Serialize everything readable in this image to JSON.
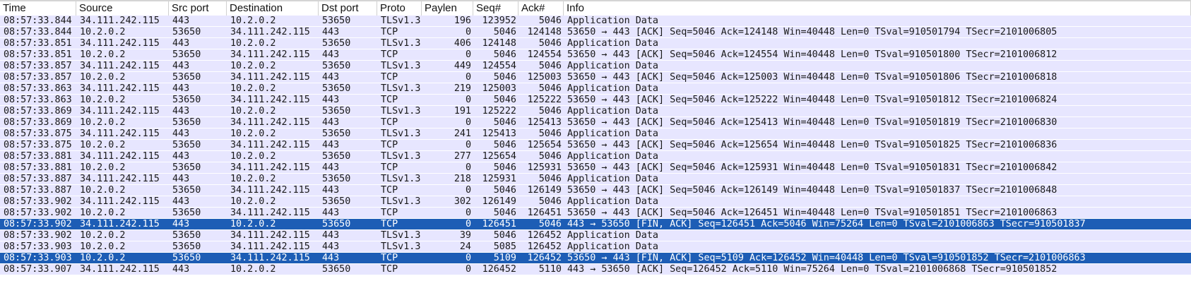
{
  "columns": [
    "Time",
    "Source",
    "Src port",
    "Destination",
    "Dst port",
    "Proto",
    "Paylen",
    "Seq#",
    "Ack#",
    "Info"
  ],
  "selected_color": "#1d5db5",
  "row_color": "#e7e6ff",
  "rows": [
    [
      "08:57:33.844",
      "34.111.242.115",
      "443",
      "10.2.0.2",
      "53650",
      "TLSv1.3",
      "196",
      "123952",
      "5046",
      "Application Data",
      false
    ],
    [
      "08:57:33.844",
      "10.2.0.2",
      "53650",
      "34.111.242.115",
      "443",
      "TCP",
      "0",
      "5046",
      "124148",
      "53650 → 443 [ACK] Seq=5046 Ack=124148 Win=40448 Len=0 TSval=910501794 TSecr=2101006805",
      false
    ],
    [
      "08:57:33.851",
      "34.111.242.115",
      "443",
      "10.2.0.2",
      "53650",
      "TLSv1.3",
      "406",
      "124148",
      "5046",
      "Application Data",
      false
    ],
    [
      "08:57:33.851",
      "10.2.0.2",
      "53650",
      "34.111.242.115",
      "443",
      "TCP",
      "0",
      "5046",
      "124554",
      "53650 → 443 [ACK] Seq=5046 Ack=124554 Win=40448 Len=0 TSval=910501800 TSecr=2101006812",
      false
    ],
    [
      "08:57:33.857",
      "34.111.242.115",
      "443",
      "10.2.0.2",
      "53650",
      "TLSv1.3",
      "449",
      "124554",
      "5046",
      "Application Data",
      false
    ],
    [
      "08:57:33.857",
      "10.2.0.2",
      "53650",
      "34.111.242.115",
      "443",
      "TCP",
      "0",
      "5046",
      "125003",
      "53650 → 443 [ACK] Seq=5046 Ack=125003 Win=40448 Len=0 TSval=910501806 TSecr=2101006818",
      false
    ],
    [
      "08:57:33.863",
      "34.111.242.115",
      "443",
      "10.2.0.2",
      "53650",
      "TLSv1.3",
      "219",
      "125003",
      "5046",
      "Application Data",
      false
    ],
    [
      "08:57:33.863",
      "10.2.0.2",
      "53650",
      "34.111.242.115",
      "443",
      "TCP",
      "0",
      "5046",
      "125222",
      "53650 → 443 [ACK] Seq=5046 Ack=125222 Win=40448 Len=0 TSval=910501812 TSecr=2101006824",
      false
    ],
    [
      "08:57:33.869",
      "34.111.242.115",
      "443",
      "10.2.0.2",
      "53650",
      "TLSv1.3",
      "191",
      "125222",
      "5046",
      "Application Data",
      false
    ],
    [
      "08:57:33.869",
      "10.2.0.2",
      "53650",
      "34.111.242.115",
      "443",
      "TCP",
      "0",
      "5046",
      "125413",
      "53650 → 443 [ACK] Seq=5046 Ack=125413 Win=40448 Len=0 TSval=910501819 TSecr=2101006830",
      false
    ],
    [
      "08:57:33.875",
      "34.111.242.115",
      "443",
      "10.2.0.2",
      "53650",
      "TLSv1.3",
      "241",
      "125413",
      "5046",
      "Application Data",
      false
    ],
    [
      "08:57:33.875",
      "10.2.0.2",
      "53650",
      "34.111.242.115",
      "443",
      "TCP",
      "0",
      "5046",
      "125654",
      "53650 → 443 [ACK] Seq=5046 Ack=125654 Win=40448 Len=0 TSval=910501825 TSecr=2101006836",
      false
    ],
    [
      "08:57:33.881",
      "34.111.242.115",
      "443",
      "10.2.0.2",
      "53650",
      "TLSv1.3",
      "277",
      "125654",
      "5046",
      "Application Data",
      false
    ],
    [
      "08:57:33.881",
      "10.2.0.2",
      "53650",
      "34.111.242.115",
      "443",
      "TCP",
      "0",
      "5046",
      "125931",
      "53650 → 443 [ACK] Seq=5046 Ack=125931 Win=40448 Len=0 TSval=910501831 TSecr=2101006842",
      false
    ],
    [
      "08:57:33.887",
      "34.111.242.115",
      "443",
      "10.2.0.2",
      "53650",
      "TLSv1.3",
      "218",
      "125931",
      "5046",
      "Application Data",
      false
    ],
    [
      "08:57:33.887",
      "10.2.0.2",
      "53650",
      "34.111.242.115",
      "443",
      "TCP",
      "0",
      "5046",
      "126149",
      "53650 → 443 [ACK] Seq=5046 Ack=126149 Win=40448 Len=0 TSval=910501837 TSecr=2101006848",
      false
    ],
    [
      "08:57:33.902",
      "34.111.242.115",
      "443",
      "10.2.0.2",
      "53650",
      "TLSv1.3",
      "302",
      "126149",
      "5046",
      "Application Data",
      false
    ],
    [
      "08:57:33.902",
      "10.2.0.2",
      "53650",
      "34.111.242.115",
      "443",
      "TCP",
      "0",
      "5046",
      "126451",
      "53650 → 443 [ACK] Seq=5046 Ack=126451 Win=40448 Len=0 TSval=910501851 TSecr=2101006863",
      false
    ],
    [
      "08:57:33.902",
      "34.111.242.115",
      "443",
      "10.2.0.2",
      "53650",
      "TCP",
      "0",
      "126451",
      "5046",
      "443 → 53650 [FIN, ACK] Seq=126451 Ack=5046 Win=75264 Len=0 TSval=2101006863 TSecr=910501837",
      true
    ],
    [
      "08:57:33.902",
      "10.2.0.2",
      "53650",
      "34.111.242.115",
      "443",
      "TLSv1.3",
      "39",
      "5046",
      "126452",
      "Application Data",
      false
    ],
    [
      "08:57:33.903",
      "10.2.0.2",
      "53650",
      "34.111.242.115",
      "443",
      "TLSv1.3",
      "24",
      "5085",
      "126452",
      "Application Data",
      false
    ],
    [
      "08:57:33.903",
      "10.2.0.2",
      "53650",
      "34.111.242.115",
      "443",
      "TCP",
      "0",
      "5109",
      "126452",
      "53650 → 443 [FIN, ACK] Seq=5109 Ack=126452 Win=40448 Len=0 TSval=910501852 TSecr=2101006863",
      true
    ],
    [
      "08:57:33.907",
      "34.111.242.115",
      "443",
      "10.2.0.2",
      "53650",
      "TCP",
      "0",
      "126452",
      "5110",
      "443 → 53650 [ACK] Seq=126452 Ack=5110 Win=75264 Len=0 TSval=2101006868 TSecr=910501852",
      false
    ]
  ]
}
